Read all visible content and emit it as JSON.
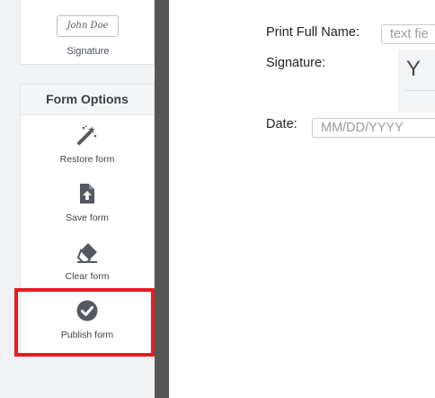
{
  "sidebar": {
    "signature_card": {
      "sample_text": "John Doe",
      "label": "Signature"
    },
    "form_options": {
      "header": "Form Options",
      "items": [
        {
          "label": "Restore form",
          "icon": "magic-wand-icon"
        },
        {
          "label": "Save form",
          "icon": "file-upload-icon"
        },
        {
          "label": "Clear form",
          "icon": "eraser-icon"
        },
        {
          "label": "Publish form",
          "icon": "check-circle-icon"
        }
      ]
    },
    "highlighted_item": "Publish form",
    "highlight_color": "#e41c24"
  },
  "form": {
    "print_name": {
      "label": "Print Full Name:",
      "placeholder": "text fie"
    },
    "signature": {
      "label": "Signature:",
      "glyph": "Y"
    },
    "date": {
      "label": "Date:",
      "placeholder": "MM/DD/YYYY"
    }
  }
}
